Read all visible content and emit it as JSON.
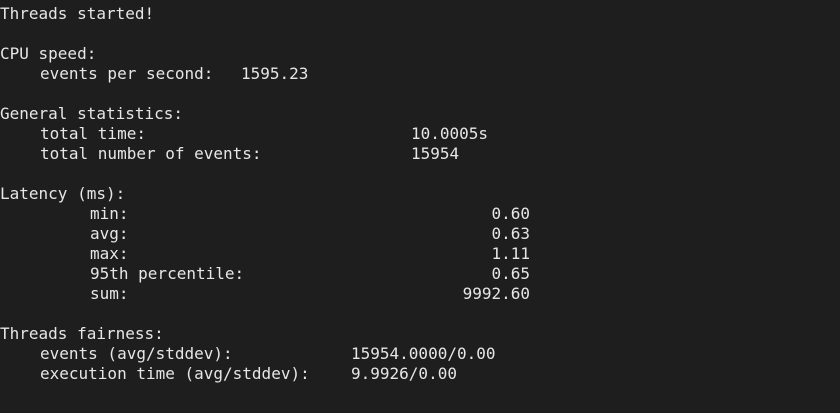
{
  "terminal": {
    "header": "Threads started!",
    "cpu_speed": {
      "title": "CPU speed:",
      "events_per_second_label": "events per second:",
      "events_per_second_value": "1595.23"
    },
    "general": {
      "title": "General statistics:",
      "total_time_label": "total time:",
      "total_time_value": "10.0005s",
      "total_events_label": "total number of events:",
      "total_events_value": "15954"
    },
    "latency": {
      "title": "Latency (ms):",
      "min_label": "min:",
      "min_value": "0.60",
      "avg_label": "avg:",
      "avg_value": "0.63",
      "max_label": "max:",
      "max_value": "1.11",
      "p95_label": "95th percentile:",
      "p95_value": "0.65",
      "sum_label": "sum:",
      "sum_value": "9992.60"
    },
    "fairness": {
      "title": "Threads fairness:",
      "events_label": "events (avg/stddev):",
      "events_value": "15954.0000/0.00",
      "exec_label": "execution time (avg/stddev):",
      "exec_value": "9.9926/0.00"
    }
  }
}
